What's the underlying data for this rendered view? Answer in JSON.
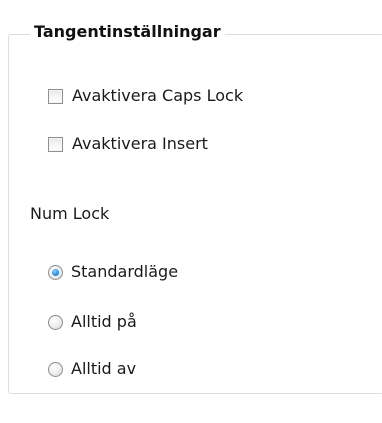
{
  "group": {
    "title": "Tangentinställningar"
  },
  "checkboxes": [
    {
      "label": "Avaktivera Caps Lock",
      "checked": false
    },
    {
      "label": "Avaktivera Insert",
      "checked": false
    }
  ],
  "numlock": {
    "label": "Num Lock",
    "options": [
      {
        "label": "Standardläge",
        "selected": true
      },
      {
        "label": "Alltid på",
        "selected": false
      },
      {
        "label": "Alltid av",
        "selected": false
      }
    ]
  },
  "colors": {
    "group_border": "#d5dfe5",
    "radio_selected": "#2f8ee0"
  }
}
